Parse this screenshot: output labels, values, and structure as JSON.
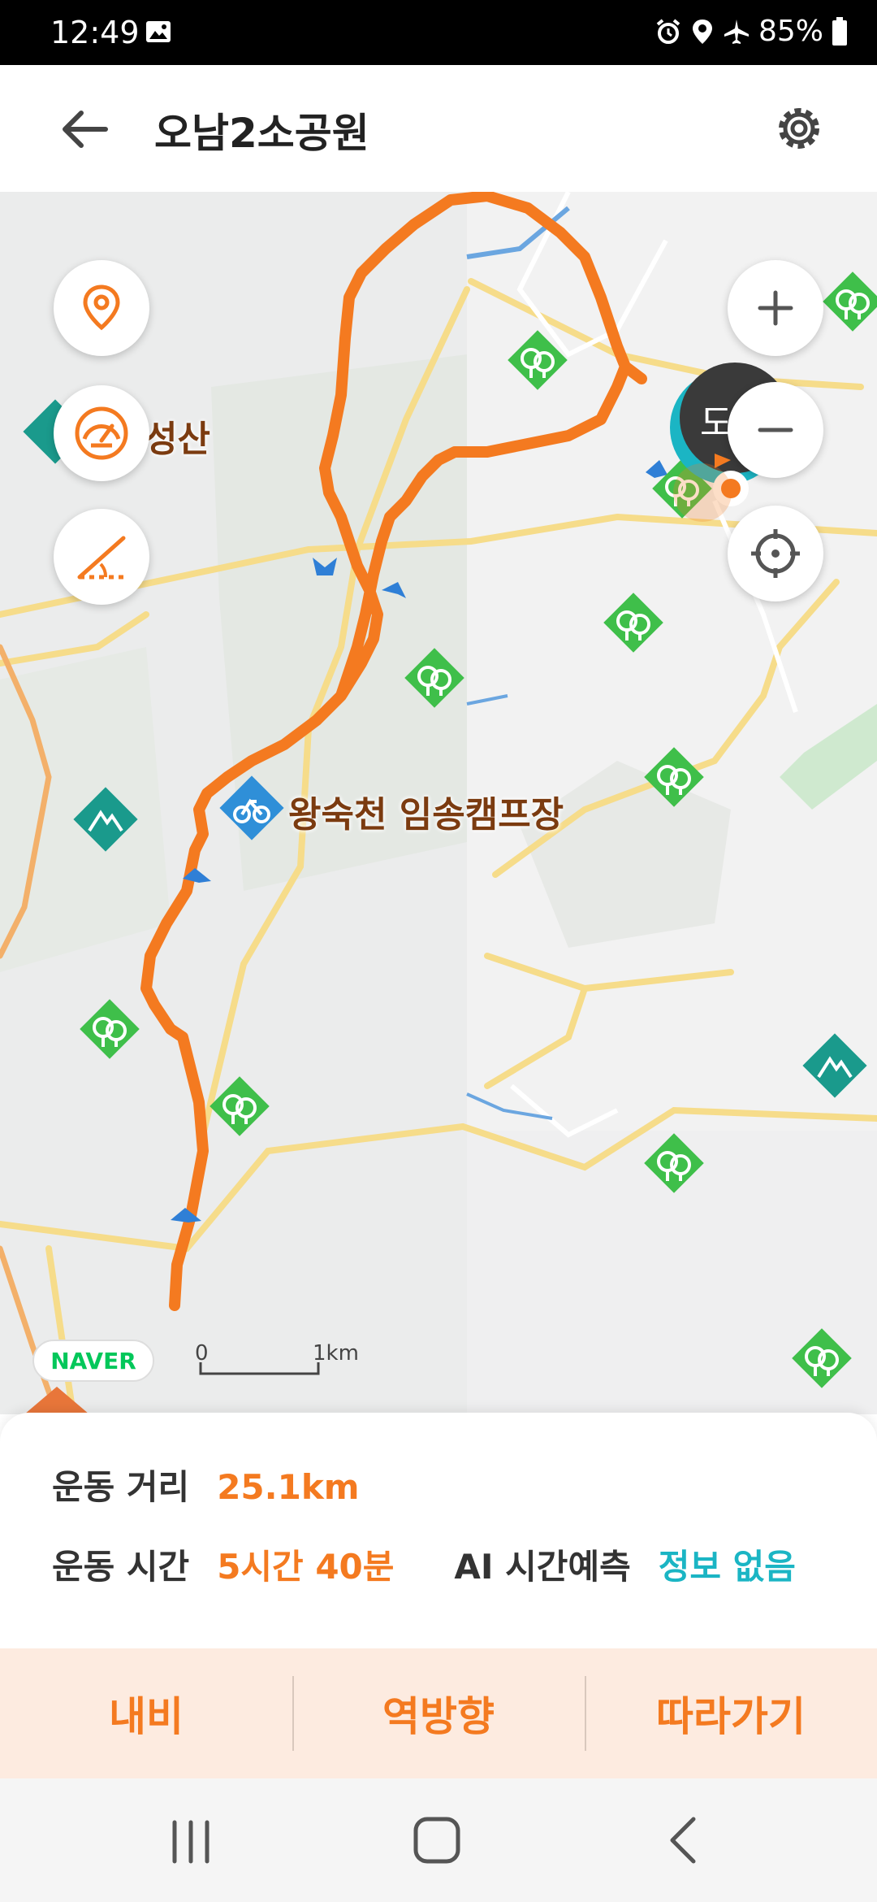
{
  "status_bar": {
    "time": "12:49",
    "battery": "85%",
    "icons": [
      "image-icon",
      "alarm-icon",
      "location-icon",
      "airplane-icon",
      "battery-icon"
    ]
  },
  "header": {
    "title": "오남2소공원",
    "back_icon": "arrow-left-icon",
    "settings_icon": "gear-icon"
  },
  "map": {
    "labels": {
      "seongsan": "성산",
      "campsite": "왕숙천 임송캠프장",
      "destination_badge": "도"
    },
    "attribution": "NAVER",
    "scale": {
      "zero": "0",
      "unit": "1km"
    },
    "controls": [
      "location-pin-icon",
      "speedometer-icon",
      "slope-icon",
      "zoom-in-icon",
      "zoom-out-icon",
      "crosshair-icon"
    ],
    "route_color": "#f47a20"
  },
  "stats": {
    "distance_label": "운동 거리",
    "distance_value": "25.1km",
    "time_label": "운동 시간",
    "time_value": "5시간 40분",
    "ai_label": "AI 시간예측",
    "ai_value": "정보 없음"
  },
  "actions": {
    "navi": "내비",
    "reverse": "역방향",
    "follow": "따라가기"
  },
  "colors": {
    "accent": "#f47a20",
    "info": "#1bb5c4",
    "action_bg": "#fdebe0",
    "park_green": "#3fbf4a",
    "mountain_teal": "#1a9a8c"
  }
}
